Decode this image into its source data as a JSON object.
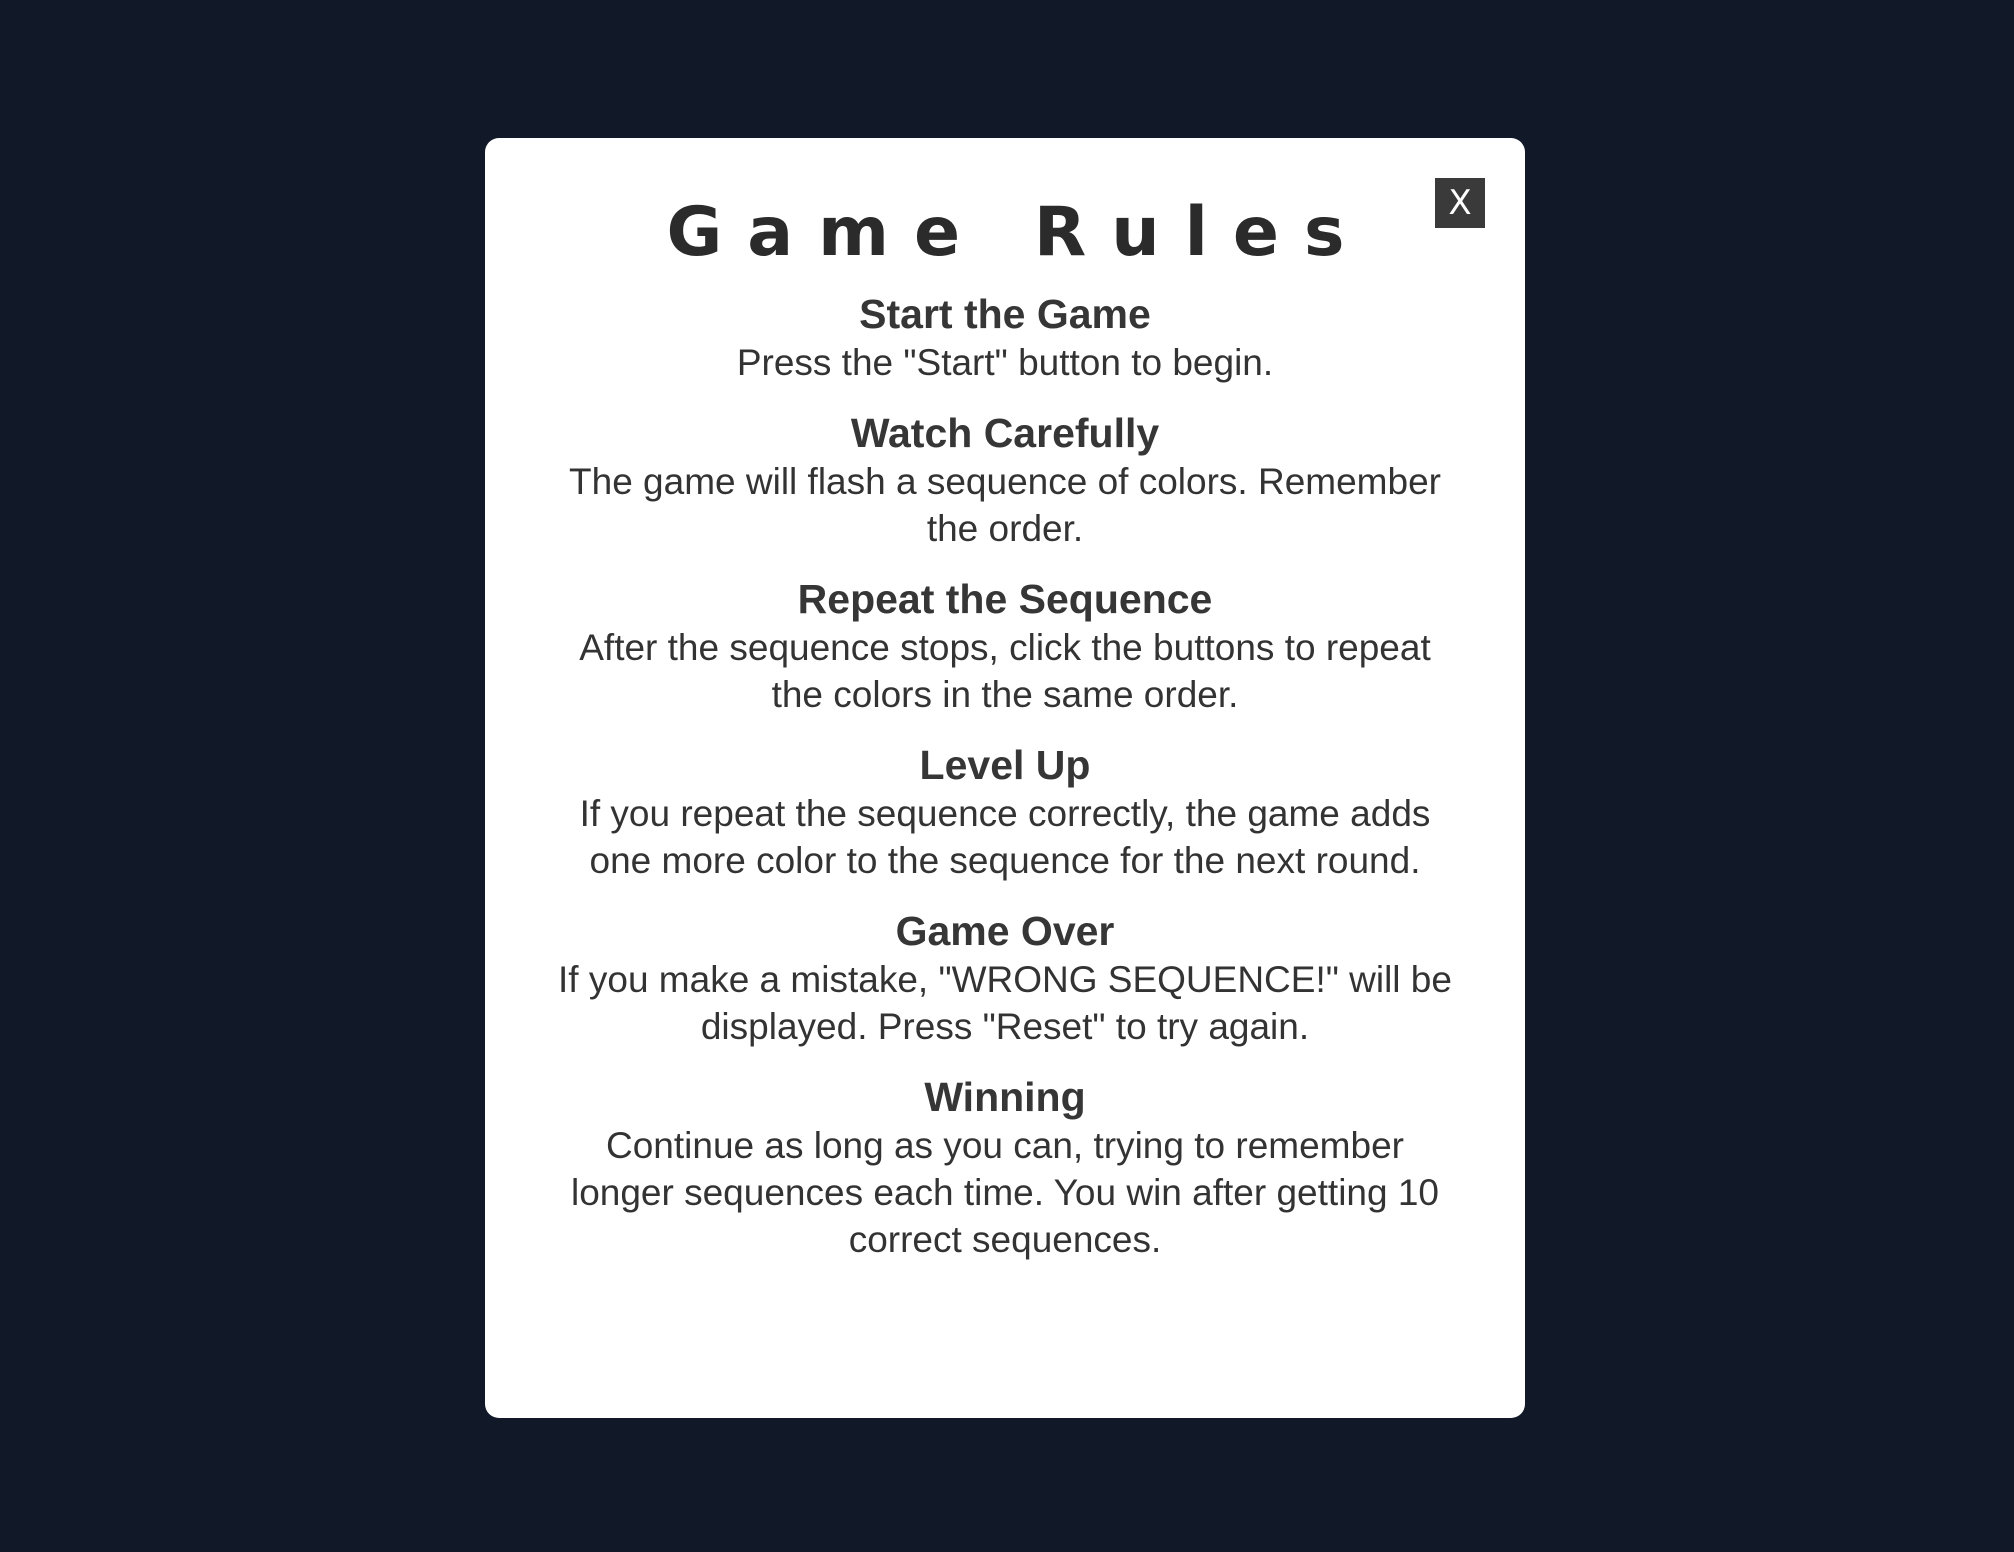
{
  "modal": {
    "title": "Game Rules",
    "close_label": "X",
    "rules": [
      {
        "title": "Start the Game",
        "text": "Press the \"Start\" button to begin."
      },
      {
        "title": "Watch Carefully",
        "text": "The game will flash a sequence of colors. Remember the order."
      },
      {
        "title": "Repeat the Sequence",
        "text": "After the sequence stops, click the buttons to repeat the colors in the same order."
      },
      {
        "title": "Level Up",
        "text": "If you repeat the sequence correctly, the game adds one more color to the sequence for the next round."
      },
      {
        "title": "Game Over",
        "text": "If you make a mistake, \"WRONG SEQUENCE!\" will be displayed. Press \"Reset\" to try again."
      },
      {
        "title": "Winning",
        "text": "Continue as long as you can, trying to remember longer sequences each time. You win after getting 10 correct sequences."
      }
    ]
  },
  "colors": {
    "background": "#111827",
    "modal": "#ffffff",
    "text": "#333333",
    "close_button": "#3a3a3a"
  }
}
